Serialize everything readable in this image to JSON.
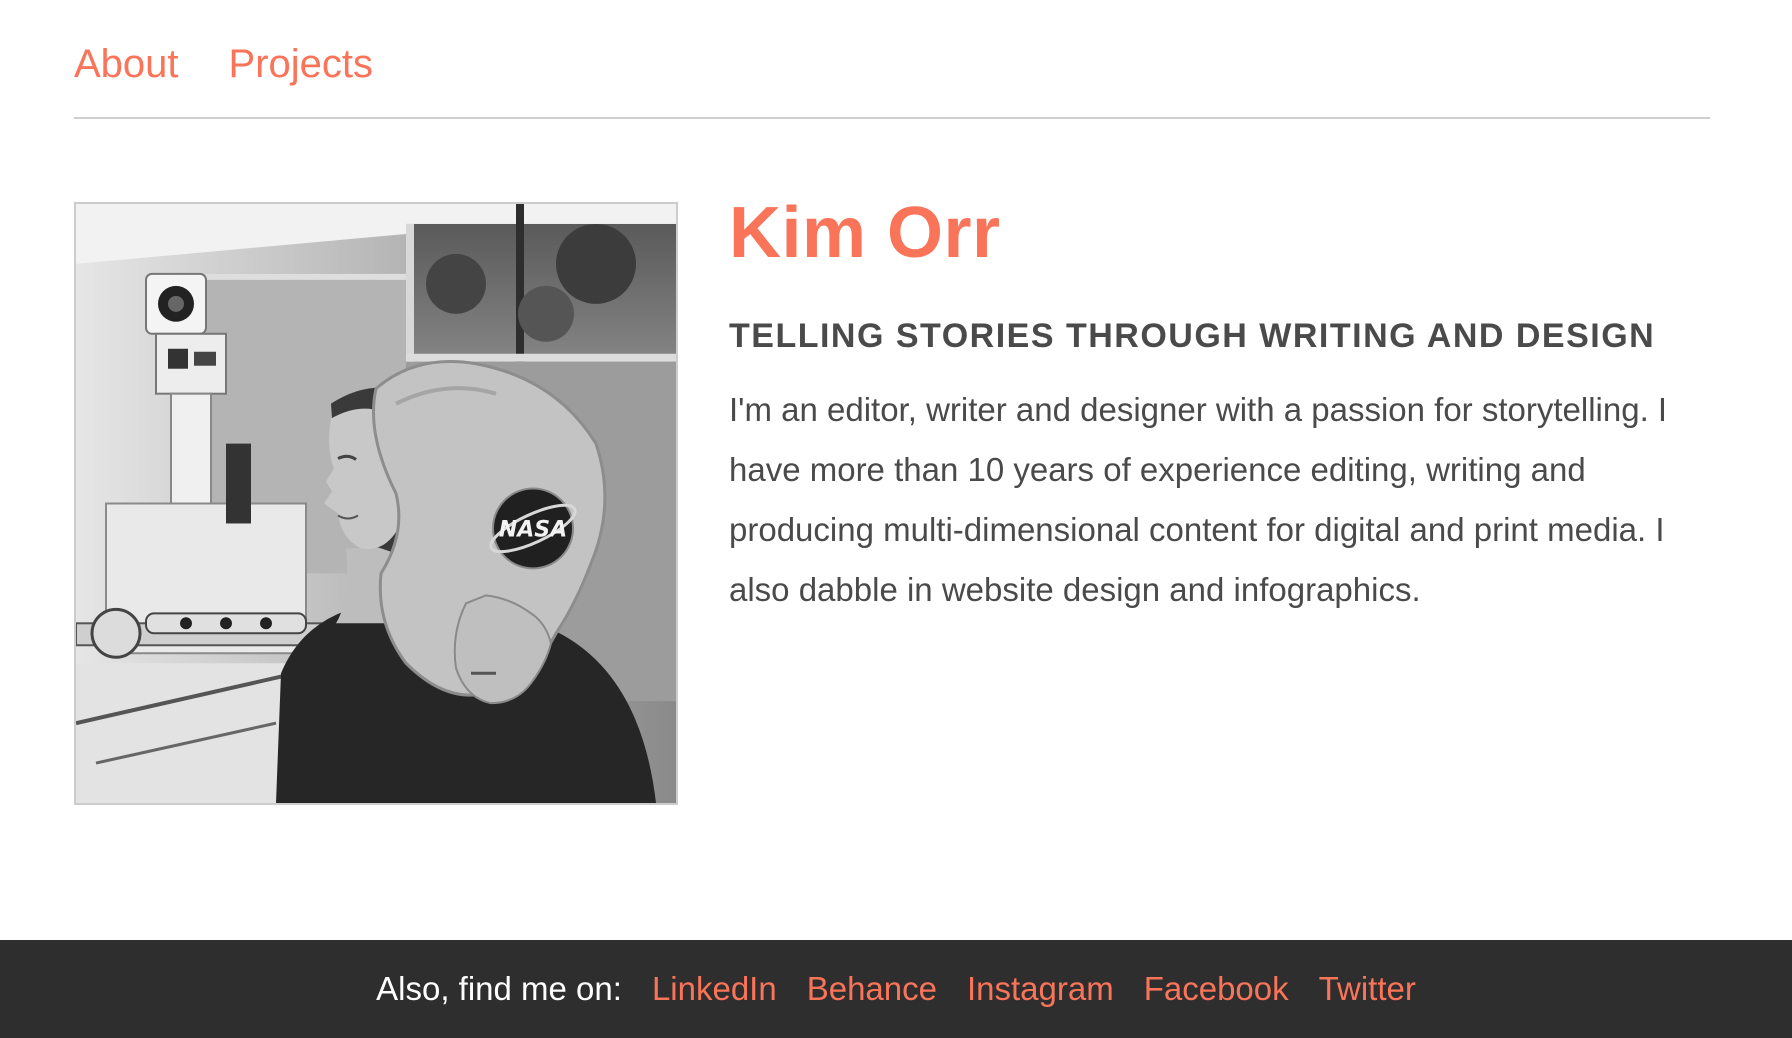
{
  "nav": {
    "about": "About",
    "projects": "Projects"
  },
  "hero": {
    "name": "Kim Orr",
    "tagline": "TELLING STORIES THROUGH WRITING AND DESIGN",
    "bio": "I'm an editor, writer and designer with a passion for storytelling. I have more than 10 years of experience editing, writing and producing multi-dimensional content for digital and print media. I also dabble in website design and infographics.",
    "photo_badge_text": "NASA"
  },
  "footer": {
    "label": "Also, find me on:",
    "links": [
      "LinkedIn",
      "Behance",
      "Instagram",
      "Facebook",
      "Twitter"
    ]
  },
  "colors": {
    "accent": "#f97459",
    "text": "#4a4a4a",
    "footer_bg": "#2e2e2e",
    "rule": "#cfcfcf"
  }
}
